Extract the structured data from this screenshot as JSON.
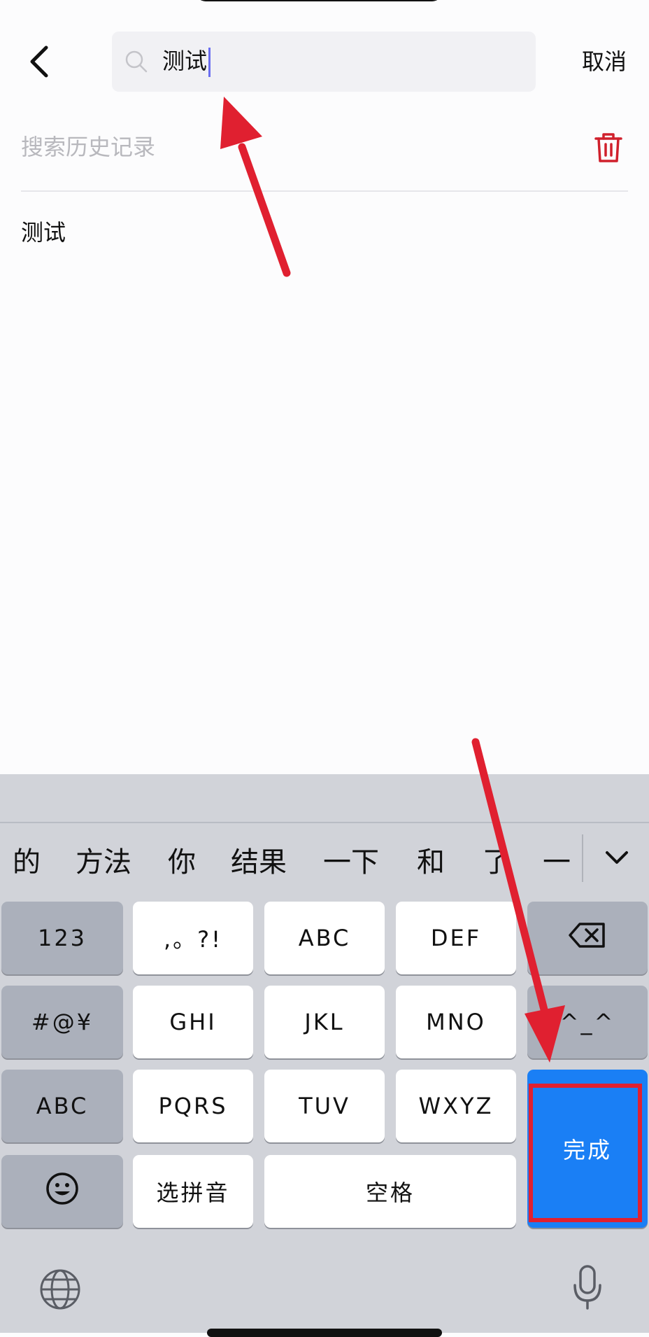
{
  "header": {
    "search_value": "测试",
    "cancel_label": "取消"
  },
  "history": {
    "title": "搜索历史记录",
    "items": [
      "测试"
    ]
  },
  "keyboard": {
    "candidates": [
      "的",
      "方法",
      "你",
      "结果",
      "一下",
      "和",
      "了",
      "一"
    ],
    "rows": [
      [
        "123",
        ",。?!",
        "ABC",
        "DEF"
      ],
      [
        "#@¥",
        "GHI",
        "JKL",
        "MNO",
        "^_^"
      ],
      [
        "ABC",
        "PQRS",
        "TUV",
        "WXYZ"
      ]
    ],
    "pinyin_label": "选拼音",
    "space_label": "空格",
    "done_label": "完成"
  },
  "colors": {
    "accent_blue": "#1a7ff5",
    "annotation_red": "#e02030",
    "trash_red": "#d0202c"
  },
  "icons": [
    "back-icon",
    "search-icon",
    "trash-icon",
    "chevron-down-icon",
    "backspace-icon",
    "emoji-icon",
    "globe-icon",
    "microphone-icon"
  ]
}
